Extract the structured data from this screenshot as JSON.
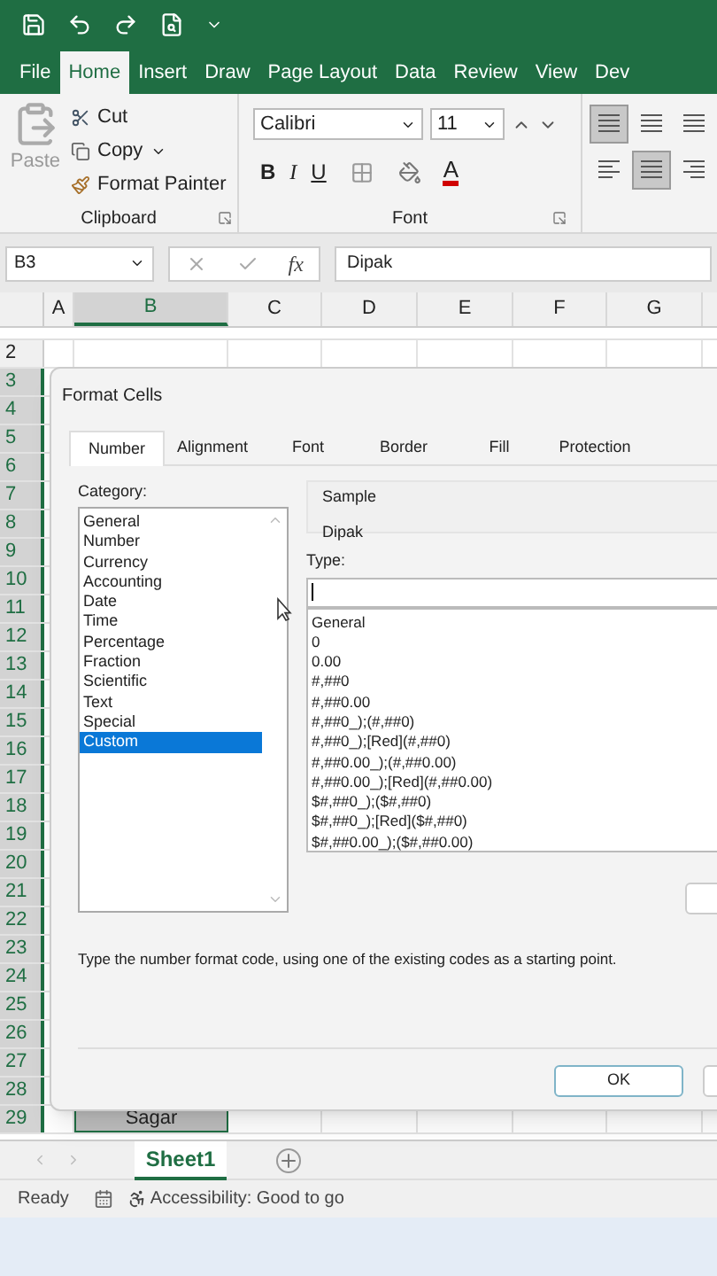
{
  "ribbon_tabs": [
    {
      "label": "File",
      "selected": false
    },
    {
      "label": "Home",
      "selected": true
    },
    {
      "label": "Insert",
      "selected": false
    },
    {
      "label": "Draw",
      "selected": false
    },
    {
      "label": "Page Layout",
      "selected": false
    },
    {
      "label": "Data",
      "selected": false
    },
    {
      "label": "Review",
      "selected": false
    },
    {
      "label": "View",
      "selected": false
    },
    {
      "label": "Dev",
      "selected": false
    }
  ],
  "clipboard": {
    "paste": "Paste",
    "cut": "Cut",
    "copy": "Copy",
    "format_painter": "Format Painter",
    "label": "Clipboard"
  },
  "font": {
    "name": "Calibri",
    "size": "11",
    "bold": "B",
    "italic": "I",
    "underline": "U",
    "font_color": "A",
    "label": "Font"
  },
  "vertical_align": [
    {
      "selected": true
    },
    {
      "selected": false
    },
    {
      "selected": false
    }
  ],
  "horizontal_align": [
    {
      "selected": false
    },
    {
      "selected": true
    },
    {
      "selected": false
    }
  ],
  "formula_bar": {
    "name_box": "B3",
    "fx": "fx",
    "value": "Dipak"
  },
  "columns": [
    {
      "label": "A",
      "selected": false
    },
    {
      "label": "B",
      "selected": true
    },
    {
      "label": "C",
      "selected": false
    },
    {
      "label": "D",
      "selected": false
    },
    {
      "label": "E",
      "selected": false
    },
    {
      "label": "F",
      "selected": false
    },
    {
      "label": "G",
      "selected": false
    }
  ],
  "rows": [
    {
      "label": "2",
      "selected": false
    },
    {
      "label": "3",
      "selected": true
    },
    {
      "label": "4",
      "selected": true
    },
    {
      "label": "5",
      "selected": true
    },
    {
      "label": "6",
      "selected": true
    },
    {
      "label": "7",
      "selected": true
    },
    {
      "label": "8",
      "selected": true
    },
    {
      "label": "9",
      "selected": true
    },
    {
      "label": "10",
      "selected": true
    },
    {
      "label": "11",
      "selected": true
    },
    {
      "label": "12",
      "selected": true
    },
    {
      "label": "13",
      "selected": true
    },
    {
      "label": "14",
      "selected": true
    },
    {
      "label": "15",
      "selected": true
    },
    {
      "label": "16",
      "selected": true
    },
    {
      "label": "17",
      "selected": true
    },
    {
      "label": "18",
      "selected": true
    },
    {
      "label": "19",
      "selected": true
    },
    {
      "label": "20",
      "selected": true
    },
    {
      "label": "21",
      "selected": true
    },
    {
      "label": "22",
      "selected": true
    },
    {
      "label": "23",
      "selected": true
    },
    {
      "label": "24",
      "selected": true
    },
    {
      "label": "25",
      "selected": true
    },
    {
      "label": "26",
      "selected": true
    },
    {
      "label": "27",
      "selected": true
    },
    {
      "label": "28",
      "selected": true
    },
    {
      "label": "29",
      "selected": true
    }
  ],
  "cell_b29": "Sagar",
  "dialog": {
    "title": "Format Cells",
    "tabs": [
      {
        "label": "Number",
        "selected": true
      },
      {
        "label": "Alignment",
        "selected": false
      },
      {
        "label": "Font",
        "selected": false
      },
      {
        "label": "Border",
        "selected": false
      },
      {
        "label": "Fill",
        "selected": false
      },
      {
        "label": "Protection",
        "selected": false
      }
    ],
    "category_label": "Category:",
    "categories": [
      {
        "label": "General",
        "selected": false
      },
      {
        "label": "Number",
        "selected": false
      },
      {
        "label": "Currency",
        "selected": false
      },
      {
        "label": "Accounting",
        "selected": false
      },
      {
        "label": "Date",
        "selected": false
      },
      {
        "label": "Time",
        "selected": false
      },
      {
        "label": "Percentage",
        "selected": false
      },
      {
        "label": "Fraction",
        "selected": false
      },
      {
        "label": "Scientific",
        "selected": false
      },
      {
        "label": "Text",
        "selected": false
      },
      {
        "label": "Special",
        "selected": false
      },
      {
        "label": "Custom",
        "selected": true
      }
    ],
    "sample_label": "Sample",
    "sample_value": "Dipak",
    "type_label": "Type:",
    "type_list": [
      "General",
      "0",
      "0.00",
      "#,##0",
      "#,##0.00",
      "#,##0_);(#,##0)",
      "#,##0_);[Red](#,##0)",
      "#,##0.00_);(#,##0.00)",
      "#,##0.00_);[Red](#,##0.00)",
      "$#,##0_);($#,##0)",
      "$#,##0_);[Red]($#,##0)",
      "$#,##0.00_);($#,##0.00)"
    ],
    "description": "Type the number format code, using one of the existing codes as a starting point.",
    "ok": "OK"
  },
  "sheet_tabs": [
    {
      "label": "Sheet1",
      "selected": true
    }
  ],
  "status": {
    "ready": "Ready",
    "accessibility": "Accessibility: Good to go"
  }
}
